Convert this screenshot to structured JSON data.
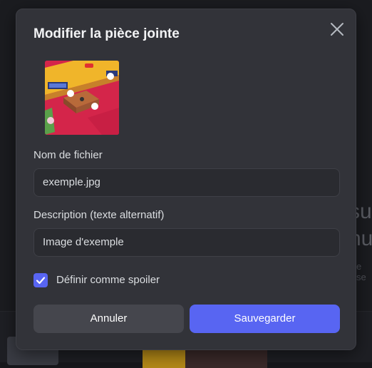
{
  "modal": {
    "title": "Modifier la pièce jointe",
    "filename_label": "Nom de fichier",
    "filename_value": "exemple.jpg",
    "description_label": "Description (texte alternatif)",
    "description_value": "Image d'exemple",
    "spoiler_label": "Définir comme spoiler",
    "spoiler_checked": true,
    "cancel_label": "Annuler",
    "save_label": "Sauvegarder"
  },
  "background": {
    "text_line1": "su",
    "text_line2": "nu",
    "text_line3": "e se"
  },
  "colors": {
    "accent": "#5865f2",
    "modal_bg": "#323339",
    "input_bg": "#2a2b30",
    "cancel_bg": "#45464d"
  },
  "icons": {
    "close": "close-icon",
    "check": "checkmark-icon",
    "thumbnail": "attachment-thumbnail"
  }
}
